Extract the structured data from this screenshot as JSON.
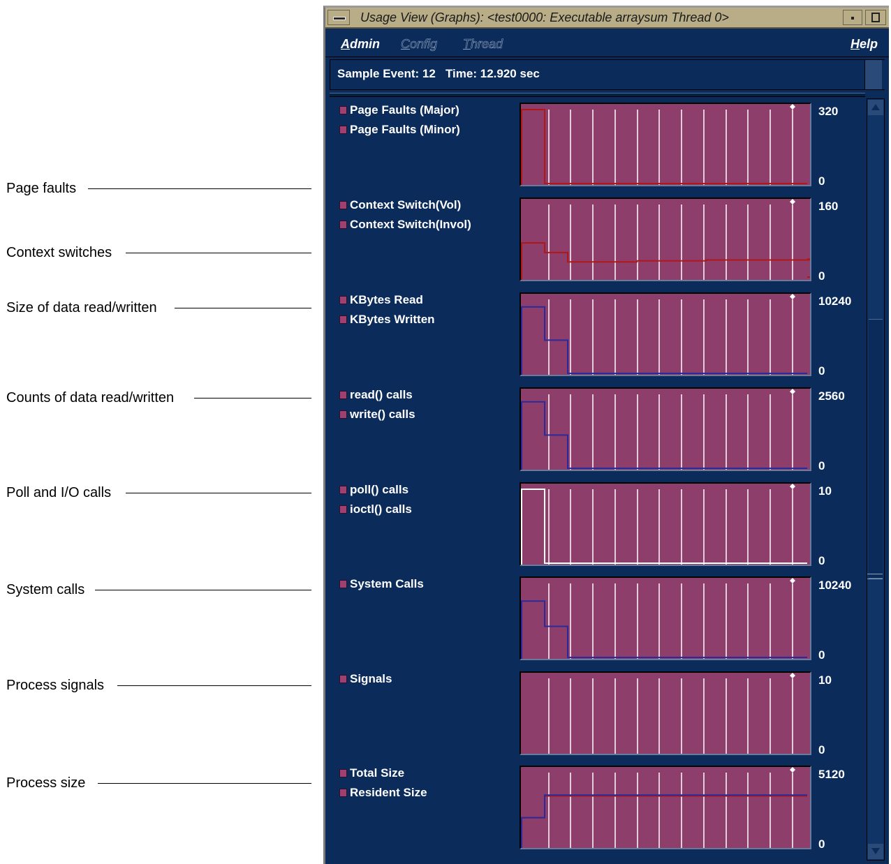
{
  "annotations": [
    {
      "label": "Page faults"
    },
    {
      "label": "Context switches"
    },
    {
      "label": "Size of data read/written"
    },
    {
      "label": "Counts of data read/written"
    },
    {
      "label": "Poll and I/O calls"
    },
    {
      "label": "System calls"
    },
    {
      "label": "Process signals"
    },
    {
      "label": "Process size"
    }
  ],
  "window": {
    "title": "Usage View (Graphs): <test0000: Executable arraysum Thread 0>",
    "menu": {
      "admin": {
        "mnemonic": "A",
        "rest": "dmin"
      },
      "config": {
        "mnemonic": "C",
        "rest": "onfig"
      },
      "thread": {
        "mnemonic": "T",
        "rest": "hread"
      },
      "help": {
        "mnemonic": "H",
        "rest": "elp"
      }
    },
    "status": {
      "sample_event_label": "Sample Event:",
      "sample_event": "12",
      "time_label": "Time:",
      "time": "12.920 sec"
    }
  },
  "colors": {
    "window_bg": "#0b2b5a",
    "plot_bg": "#8e3e6a",
    "gridline": "#ffffff",
    "series_red": "#b01818",
    "series_blue": "#2a2a9a",
    "titlebar": "#b8ad86"
  },
  "graphs": [
    {
      "legend": [
        "Page Faults (Major)",
        "Page Faults (Minor)"
      ],
      "ymax": "320",
      "ymin": "0",
      "chart_data": {
        "type": "line",
        "ylim": [
          0,
          320
        ],
        "x": [
          0,
          1,
          2,
          3,
          4,
          5,
          6,
          7,
          8,
          9,
          10,
          11,
          12
        ],
        "series": [
          {
            "color": "#b01818",
            "values": [
              320,
              0,
              0,
              0,
              0,
              0,
              0,
              0,
              0,
              0,
              0,
              0,
              0
            ]
          }
        ]
      }
    },
    {
      "legend": [
        "Context Switch(Vol)",
        "Context Switch(Invol)"
      ],
      "ymax": "160",
      "ymin": "0",
      "chart_data": {
        "type": "line",
        "ylim": [
          0,
          160
        ],
        "x": [
          0,
          1,
          2,
          3,
          4,
          5,
          6,
          7,
          8,
          9,
          10,
          11,
          12
        ],
        "series": [
          {
            "color": "#b01818",
            "values": [
              77,
              56,
              36,
              36,
              36,
              38,
              38,
              38,
              40,
              40,
              40,
              40,
              40,
              42,
              42,
              3
            ]
          }
        ]
      }
    },
    {
      "legend": [
        "KBytes Read",
        "KBytes Written"
      ],
      "ymax": "10240",
      "ymin": "0",
      "chart_data": {
        "type": "line",
        "ylim": [
          0,
          10240
        ],
        "x": [
          0,
          1,
          2,
          3,
          4,
          5,
          6,
          7,
          8,
          9,
          10,
          11,
          12
        ],
        "series": [
          {
            "color": "#2a2a9a",
            "values": [
              9200,
              4600,
              0,
              0,
              0,
              0,
              0,
              0,
              0,
              0,
              0,
              0,
              0
            ]
          }
        ]
      }
    },
    {
      "legend": [
        "read() calls",
        "write() calls"
      ],
      "ymax": "2560",
      "ymin": "0",
      "chart_data": {
        "type": "line",
        "ylim": [
          0,
          2560
        ],
        "x": [
          0,
          1,
          2,
          3,
          4,
          5,
          6,
          7,
          8,
          9,
          10,
          11,
          12
        ],
        "series": [
          {
            "color": "#2a2a9a",
            "values": [
              2300,
              1150,
              0,
              0,
              0,
              0,
              0,
              0,
              0,
              0,
              0,
              0,
              0
            ]
          }
        ]
      }
    },
    {
      "legend": [
        "poll() calls",
        "ioctl() calls"
      ],
      "ymax": "10",
      "ymin": "0",
      "chart_data": {
        "type": "line",
        "ylim": [
          0,
          10
        ],
        "x": [
          0,
          1,
          2,
          3,
          4,
          5,
          6,
          7,
          8,
          9,
          10,
          11,
          12
        ],
        "series": [
          {
            "color": "#ffffff",
            "values": [
              10,
              0,
              0,
              0,
              0,
              0,
              0,
              0,
              0,
              0,
              0,
              0,
              0
            ]
          }
        ]
      }
    },
    {
      "legend": [
        "System Calls"
      ],
      "ymax": "10240",
      "ymin": "0",
      "chart_data": {
        "type": "line",
        "ylim": [
          0,
          10240
        ],
        "x": [
          0,
          1,
          2,
          3,
          4,
          5,
          6,
          7,
          8,
          9,
          10,
          11,
          12
        ],
        "series": [
          {
            "color": "#2a2a9a",
            "values": [
              7800,
              4300,
              0,
              0,
              0,
              0,
              0,
              0,
              0,
              0,
              0,
              0,
              0
            ]
          }
        ]
      }
    },
    {
      "legend": [
        "Signals"
      ],
      "ymax": "10",
      "ymin": "0",
      "chart_data": {
        "type": "line",
        "ylim": [
          0,
          10
        ],
        "x": [
          0,
          1,
          2,
          3,
          4,
          5,
          6,
          7,
          8,
          9,
          10,
          11,
          12
        ],
        "series": []
      }
    },
    {
      "legend": [
        "Total Size",
        "Resident Size"
      ],
      "ymax": "5120",
      "ymin": "0",
      "chart_data": {
        "type": "line",
        "ylim": [
          0,
          5120
        ],
        "x": [
          0,
          1,
          2,
          3,
          4,
          5,
          6,
          7,
          8,
          9,
          10,
          11,
          12
        ],
        "series": [
          {
            "color": "#b01818",
            "values": [
              2000,
              3500,
              3500,
              3500,
              3500,
              3500,
              3500,
              3500,
              3500,
              3500,
              3500,
              3500,
              3500
            ]
          },
          {
            "color": "#2a2a9a",
            "values": [
              2000,
              3560,
              3560,
              3560,
              3560,
              3560,
              3560,
              3560,
              3560,
              3560,
              3560,
              3560,
              3560
            ]
          }
        ]
      }
    }
  ]
}
